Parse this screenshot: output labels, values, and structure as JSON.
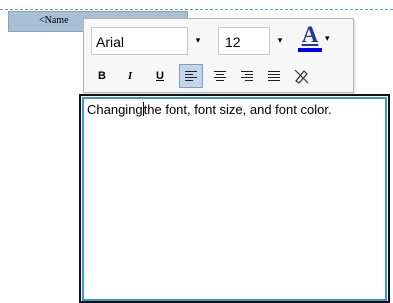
{
  "name_tag": {
    "label": "<Name"
  },
  "toolbar": {
    "font_family": "Arial",
    "font_size": "12",
    "dropdown_glyph": "▾",
    "font_color": {
      "glyph": "A",
      "value": "#0000ff"
    },
    "format": {
      "bold_label": "B",
      "italic_label": "I",
      "underline_label": "U",
      "clear_glyph": "🖉"
    }
  },
  "editor": {
    "text_before_caret": "Changing",
    "text_after_caret": "the font, font size, and font color."
  },
  "colors": {
    "guide": "#5b9bd5",
    "name_tag_bg": "#a8c0d6",
    "editor_focus_border": "#3c96d0",
    "active_button_bg": "#c4d6ea"
  },
  "icons": {
    "align_left": "align-left-icon",
    "align_center": "align-center-icon",
    "align_right": "align-right-icon",
    "align_justify": "align-justify-icon",
    "clear_format": "clear-format-icon"
  }
}
